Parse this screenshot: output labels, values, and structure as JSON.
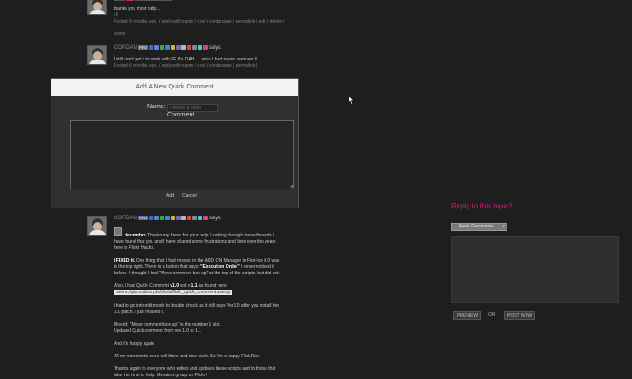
{
  "post1": {
    "lines": [
      "thanks you most ratty...",
      ";-)",
      "Posted 6 months ago. ( reply with name / cool / cordaname | permalink | edit | delete )",
      "quote"
    ]
  },
  "post2": {
    "author": "CORDAN",
    "says": "says:",
    "lines": [
      "I still can't get it to work with FF 8.x DAH... I wish I had never seen ver 8.",
      "Posted 6 months ago. ( reply with name / cool / cordaname | permalink )"
    ]
  },
  "modal": {
    "title": "Add A New Quick Comment",
    "name_label": "Name:",
    "name_placeholder": "Choose a name",
    "comment_label": "Comment",
    "add_label": "Add",
    "cancel_label": "Cancel"
  },
  "post3": {
    "author": "CORDAN",
    "pro": "PRO",
    "says": "says:",
    "l1_user": "decembre",
    "l1": "Thanks my friend for your help. Looking through these threads I",
    "l2": "have found that you and I have shared some frustrations and fixes over the years",
    "l3": "here in Flickr Hacks.",
    "fixed": "I FIXED it.",
    "l4": "One thing that I had missed in the ADD ON Manager in FireFox 8.0 was",
    "l5a": "in the top right. There is a button that says:",
    "exec": "\"Execution Order\"",
    "l5b": "I never noticed it",
    "l6": "before. I thought I had \"Move comment box up\" at the top of the scripts, but did not.",
    "l7a": "Also, I had Quick Comment",
    "l7b": "v1.0",
    "l7c": "not v",
    "l7d": "1.1",
    "l7e": "As found here",
    "url": "userscripts.org/scripts/show/flickr_quick_comment.user.js",
    "l8": "I had to go into edit mode to double check as it still says Ver1.0 after you install the",
    "l9": "1.1 patch. I just missed it.",
    "l10": "Moved: \"Move comment box up\" to the number 1 slot.",
    "l11": "Updated Quick comment from ver 1.0 to 1.1",
    "l12": "And it's happy again",
    "l13": "All my comments were still there and now work. So I'm a happy FlickRoo.",
    "l14": "Thanks again to everyone who writes and updates these scripts and to those that",
    "l15": "take the time to help. Greatest group on Flickr!"
  },
  "reply": {
    "title": "Reply to this topic?",
    "select_value": "-- Quick Comments --",
    "preview": "PREVIEW",
    "or": "OR",
    "post": "POST NOW"
  }
}
